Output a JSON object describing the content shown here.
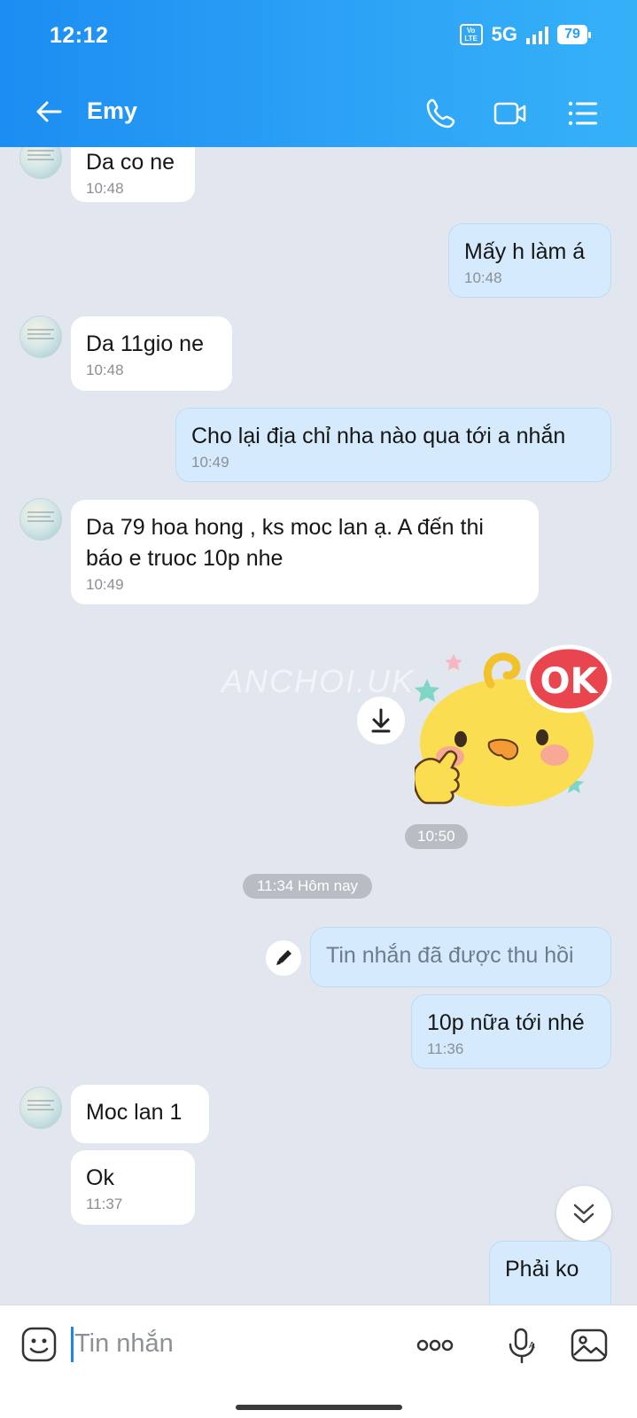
{
  "status_bar": {
    "time": "12:12",
    "volte": "Vo LTE",
    "network": "5G",
    "battery": "79"
  },
  "header": {
    "contact_name": "Emy"
  },
  "messages": [
    {
      "text": "Da co ne",
      "time": "10:48"
    },
    {
      "text": "Mấy h làm á",
      "time": "10:48"
    },
    {
      "text": "Da 11gio ne",
      "time": "10:48"
    },
    {
      "text": "Cho lại địa chỉ nha nào qua tới a nhắn",
      "time": "10:49"
    },
    {
      "text": "Da 79 hoa hong , ks moc lan ạ. A đến thi báo e truoc 10p nhe",
      "time": "10:49"
    },
    {
      "text": "",
      "time": "10:50"
    },
    {
      "text": "Tin nhắn đã được thu hồi",
      "time": ""
    },
    {
      "text": "10p nữa tới nhé",
      "time": "11:36"
    },
    {
      "text": "Moc lan 1",
      "time": ""
    },
    {
      "text": "Ok",
      "time": "11:37"
    },
    {
      "text": "Phải ko",
      "time": ""
    }
  ],
  "sticker": {
    "label": "OK"
  },
  "watermark": "ANCHOI.UK",
  "date_separator": "11:34 Hôm nay",
  "composer": {
    "placeholder": "Tin nhắn"
  },
  "colors": {
    "header_start": "#1c8df2",
    "header_end": "#35b1f8",
    "outgoing_bubble": "#d5ebfd",
    "chat_bg": "#e2e6ee"
  }
}
